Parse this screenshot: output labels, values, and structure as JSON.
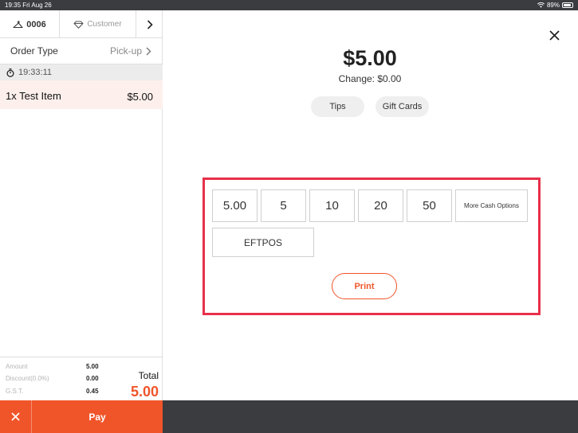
{
  "status_bar": {
    "time_date": "19:35  Fri Aug 26",
    "battery": "89%",
    "battery_level": 0.89
  },
  "order_panel": {
    "order_number": "0006",
    "customer_label": "Customer",
    "order_type_label": "Order Type",
    "order_type_value": "Pick-up",
    "timer": "19:33:11",
    "items": [
      {
        "name": "1x Test Item",
        "price": "$5.00"
      }
    ],
    "summary": {
      "amount_label": "Amount",
      "amount_value": "5.00",
      "discount_label": "Discount(0.0%)",
      "discount_value": "0.00",
      "gst_label": "G.S.T.",
      "gst_value": "0.45",
      "total_label": "Total",
      "total_value": "5.00"
    }
  },
  "bottom_bar": {
    "pay_label": "Pay"
  },
  "payment": {
    "amount_due": "$5.00",
    "change": "Change: $0.00",
    "tips_label": "Tips",
    "gift_cards_label": "Gift Cards",
    "cash_options": [
      "5.00",
      "5",
      "10",
      "20",
      "50"
    ],
    "more_cash_label": "More Cash Options",
    "eftpos_label": "EFTPOS",
    "print_label": "Print"
  },
  "colors": {
    "accent": "#f0552a",
    "highlight": "#e8304a",
    "dark_bar": "#3a3c40",
    "item_row_bg": "#fdf0ec"
  },
  "icons": {
    "order": "hanger-icon",
    "customer": "diamond-icon",
    "next": "chevron-right-icon",
    "order_type": "chevron-right-icon",
    "timer": "stopwatch-icon",
    "cancel": "close-icon",
    "close": "close-icon",
    "wifi": "wifi-icon",
    "battery": "battery-icon"
  }
}
